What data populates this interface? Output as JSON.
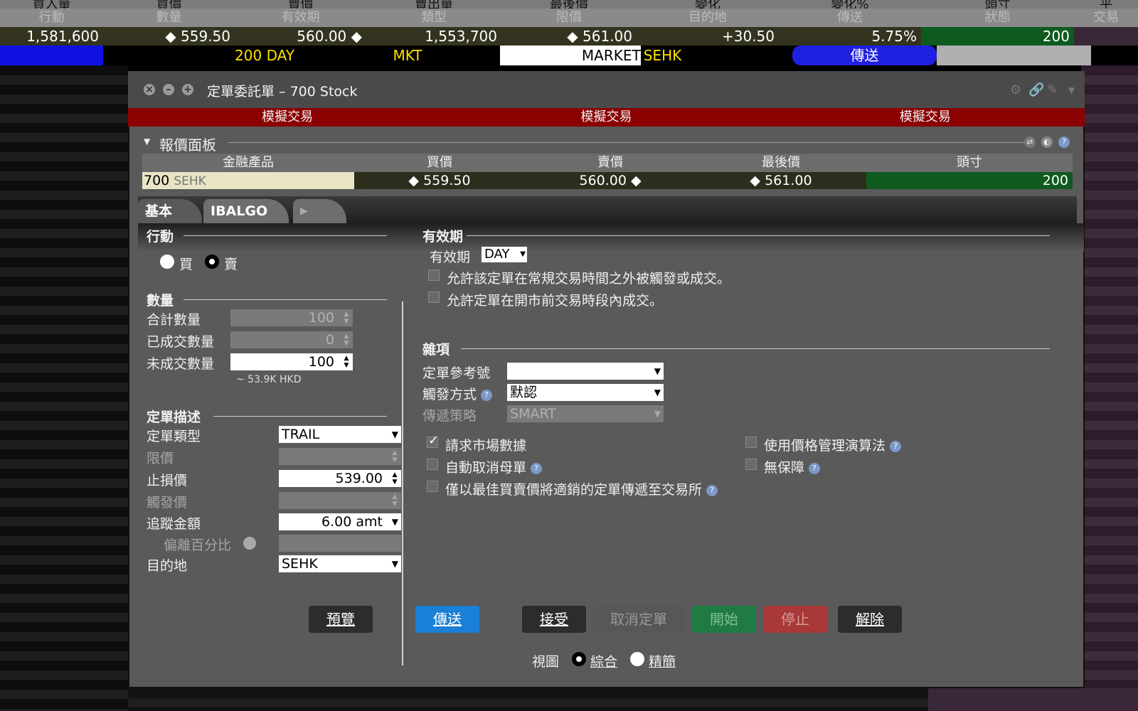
{
  "background": {
    "header1": [
      "買入量",
      "買價",
      "賣價",
      "賣出量",
      "最後價",
      "變化",
      "變化%",
      "頭寸",
      "平"
    ],
    "header2": [
      "行動",
      "數量",
      "有效期",
      "類型",
      "限價",
      "目的地",
      "傳送",
      "狀態",
      "交易"
    ],
    "values": [
      "1,581,600",
      "◆ 559.50",
      "560.00 ◆",
      "1,553,700",
      "◆ 561.00",
      "+30.50",
      "5.75%",
      "200",
      ""
    ],
    "order": {
      "qty_tif": "200  DAY",
      "type": "MKT",
      "market": "MARKET",
      "dest": "SEHK",
      "transmit": "傳送"
    }
  },
  "dialog": {
    "title": "定單委託單 – 700 Stock",
    "sim_banner": [
      "模擬交易",
      "模擬交易",
      "模擬交易"
    ],
    "quote_panel": {
      "title": "報價面板",
      "headers": [
        "金融產品",
        "買價",
        "賣價",
        "最後價",
        "頭寸"
      ],
      "symbol": "700",
      "exchange": "SEHK",
      "bid": "◆ 559.50",
      "ask": "560.00 ◆",
      "last": "◆ 561.00",
      "position": "200"
    },
    "tabs": [
      "基本",
      "IBALGO"
    ],
    "action": {
      "title": "行動",
      "buy": "買",
      "sell": "賣"
    },
    "quantity": {
      "title": "數量",
      "total_label": "合計數量",
      "total": "100",
      "filled_label": "已成交數量",
      "filled": "0",
      "remaining_label": "未成交數量",
      "remaining": "100",
      "estimate": "~ 53.9K HKD"
    },
    "order_desc": {
      "title": "定單描述",
      "type_label": "定單類型",
      "type": "TRAIL",
      "limit_label": "限價",
      "stop_label": "止損價",
      "stop": "539.00",
      "trigger_label": "觸發價",
      "trail_label": "追蹤金額",
      "trail": "6.00 amt",
      "offset_label": "偏離百分比",
      "dest_label": "目的地",
      "dest": "SEHK"
    },
    "tif": {
      "title": "有效期",
      "label": "有效期",
      "value": "DAY",
      "opt1": "允許該定單在常規交易時間之外被觸發或成交。",
      "opt2": "允許定單在開市前交易時段內成交。"
    },
    "misc": {
      "title": "雜項",
      "ref_label": "定單參考號",
      "trigger_label": "觸發方式",
      "trigger": "默認",
      "route_label": "傳遞策略",
      "route": "SMART",
      "chk_mktdata": "請求市場數據",
      "chk_autocancel": "自動取消母單",
      "chk_nbbo": "僅以最佳買賣價將適銷的定單傳遞至交易所",
      "chk_pmalgo": "使用價格管理演算法",
      "chk_noguarantee": "無保障"
    },
    "buttons": {
      "preview": "預覽",
      "transmit": "傳送",
      "accept": "接受",
      "cancel": "取消定單",
      "start": "開始",
      "stop": "停止",
      "release": "解除"
    },
    "view": {
      "label": "視圖",
      "full": "綜合",
      "compact": "精簡"
    }
  }
}
